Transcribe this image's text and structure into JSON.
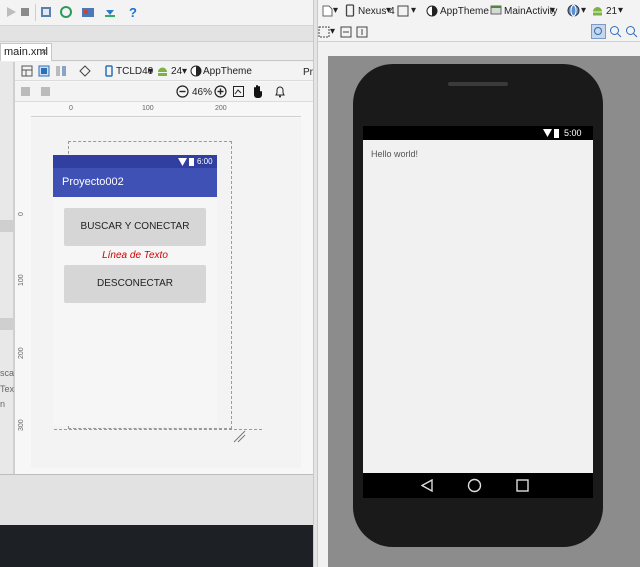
{
  "left_pane": {
    "tab": {
      "label": "main.xml",
      "close": "×"
    },
    "editor_toolbar": {
      "device": "TCLD40",
      "api": "24",
      "theme": "AppTheme",
      "zoom": "46%",
      "overflow": "Pr"
    },
    "ruler": {
      "top": [
        "0",
        "100",
        "200"
      ],
      "left": [
        "0",
        "100",
        "200",
        "300",
        "400"
      ]
    },
    "design": {
      "status_time": "6:00",
      "app_title": "Proyecto002",
      "button1": "BUSCAR Y CONECTAR",
      "text_line": "Línea de Texto",
      "button2": "DESCONECTAR"
    },
    "cut_text": [
      "scar",
      "Tex",
      "n"
    ]
  },
  "right_pane": {
    "toolbar": {
      "device": "Nexus 4",
      "theme": "AppTheme",
      "activity": "MainActivity",
      "api": "21"
    },
    "phone": {
      "status_time": "5:00",
      "hello": "Hello world!"
    }
  },
  "colors": {
    "action_bar": "#3f51b5",
    "status_bar": "#3140a0",
    "red_text": "#d00000",
    "accent_blue": "#1a6fd0"
  }
}
